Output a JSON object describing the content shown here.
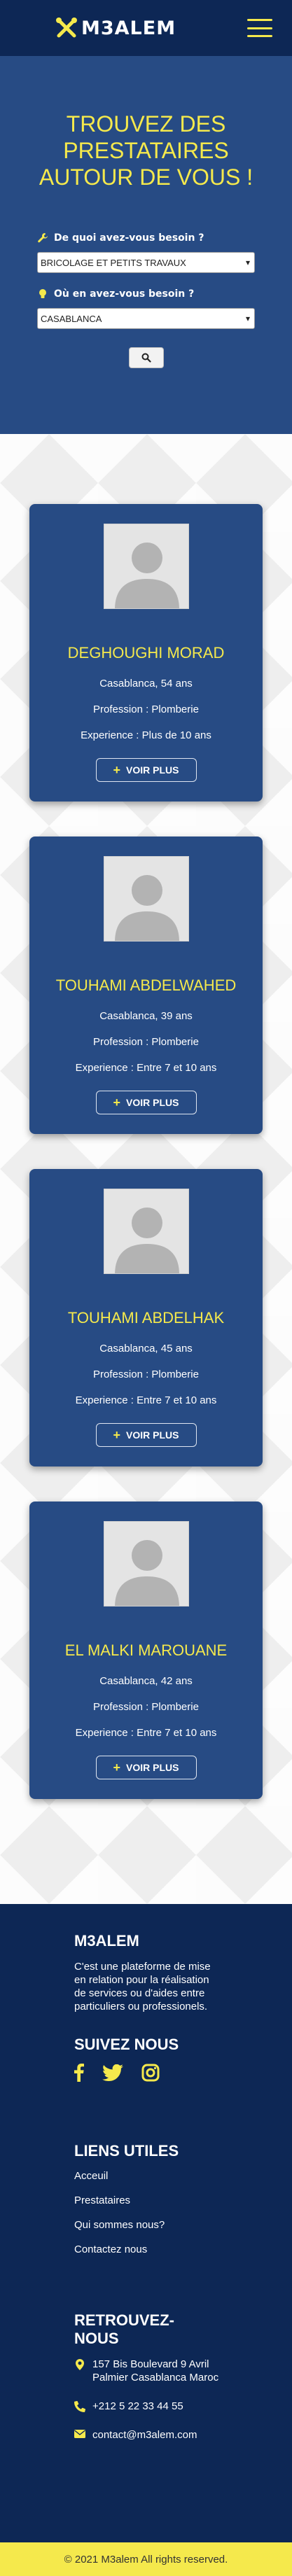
{
  "brand": {
    "name": "M3ALEM",
    "accent": "#f5e94c",
    "navy": "#0d2755",
    "blue": "#274b84"
  },
  "hero": {
    "title": "TROUVEZ DES PRESTATAIRES AUTOUR DE VOUS !",
    "need_label": "De quoi avez-vous besoin ?",
    "need_value": "BRICOLAGE ET PETITS TRAVAUX",
    "where_label": "Où en avez-vous besoin ?",
    "where_value": "CASABLANCA",
    "search_icon": "search-icon"
  },
  "providers": [
    {
      "name": "DEGHOUGHI MORAD",
      "location": "Casablanca, 54 ans",
      "profession": "Profession : Plomberie",
      "experience": "Experience : Plus de 10 ans",
      "button": "VOIR PLUS"
    },
    {
      "name": "TOUHAMI ABDELWAHED",
      "location": "Casablanca, 39 ans",
      "profession": "Profession : Plomberie",
      "experience": "Experience : Entre 7 et 10 ans",
      "button": "VOIR PLUS"
    },
    {
      "name": "TOUHAMI ABDELHAK",
      "location": "Casablanca, 45 ans",
      "profession": "Profession : Plomberie",
      "experience": "Experience : Entre 7 et 10 ans",
      "button": "VOIR PLUS"
    },
    {
      "name": "EL MALKI MAROUANE",
      "location": "Casablanca, 42 ans",
      "profession": "Profession : Plomberie",
      "experience": "Experience : Entre 7 et 10 ans",
      "button": "VOIR PLUS"
    }
  ],
  "footer": {
    "about_title": "M3ALEM",
    "about_text": "C'est une plateforme de mise en relation pour la réalisation de services ou d'aides entre particuliers ou professionels.",
    "follow_title": "SUIVEZ NOUS",
    "links_title": "LIENS UTILES",
    "links": [
      "Acceuil",
      "Prestataires",
      "Qui sommes nous?",
      "Contactez nous"
    ],
    "contact_title": "RETROUVEZ-NOUS",
    "address": "157 Bis Boulevard 9 Avril Palmier Casablanca Maroc",
    "phone": "+212 5 22 33 44 55",
    "email": "contact@m3alem.com",
    "copyright": "© 2021 M3alem All rights reserved."
  }
}
